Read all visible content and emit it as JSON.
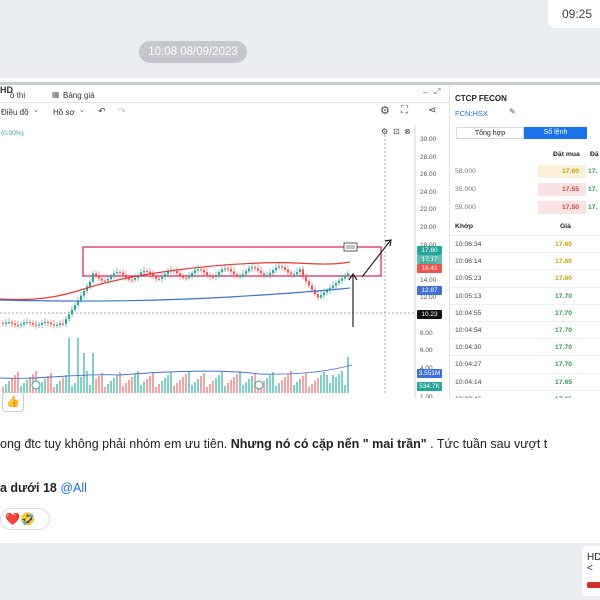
{
  "top_time": "09:25",
  "date_separator": "10:08 08/09/2023",
  "toolbar": {
    "hd_label": "HD",
    "tab_chart": "ồ thị",
    "tab_price_table": "Bảng giá",
    "menu_chart": "Điều đồ",
    "menu_profile": "Hồ sơ",
    "pct_change": "(0.00%)"
  },
  "price_axis": [
    "30.00",
    "28.00",
    "26.00",
    "24.00",
    "22.00",
    "20.00",
    "18.00",
    "16.00",
    "14.00",
    "12.00",
    "10.00",
    "8.00",
    "6.00",
    "4.00",
    "2.00",
    "1.00"
  ],
  "price_tags": {
    "last": "17.60",
    "mid": "17.17",
    "red": "16.41",
    "ma": "12.87",
    "ref": "10.23",
    "vol1": "3.551M",
    "vol2": "534.7K"
  },
  "order_panel": {
    "company": "CTCP FECON",
    "ticker": "FCN:HSX",
    "tab_summary": "Tổng hợp",
    "tab_orders": "Sổ lệnh",
    "col_bid": "Đặt mua",
    "col_ask": "Đặ",
    "book": [
      {
        "vol": "58.000",
        "price": "17.60",
        "ask": "17."
      },
      {
        "vol": "35.000",
        "price": "17.55",
        "ask": "17."
      },
      {
        "vol": "59.000",
        "price": "17.50",
        "ask": "17."
      }
    ],
    "trades_header_time": "Khớp",
    "trades_header_price": "Giá",
    "trades": [
      {
        "time": "10:06:34",
        "price": "17.60"
      },
      {
        "time": "10:06:14",
        "price": "17.60"
      },
      {
        "time": "10:05:23",
        "price": "17.60"
      },
      {
        "time": "10:05:13",
        "price": "17.70"
      },
      {
        "time": "10:04:55",
        "price": "17.70"
      },
      {
        "time": "10:04:54",
        "price": "17.70"
      },
      {
        "time": "10:04:30",
        "price": "17.70"
      },
      {
        "time": "10:04:27",
        "price": "17.70"
      },
      {
        "time": "10:04:14",
        "price": "17.65"
      },
      {
        "time": "10:03:46",
        "price": "17.65"
      }
    ]
  },
  "message": {
    "line1_normal": "ong đtc tuy không phải nhóm em ưu tiên. ",
    "line1_bold": "Nhưng nó có cặp nến \" mai trần\"",
    "line1_tail": " . Tức tuần sau vượt t",
    "line2_bold": "a dưới 18 ",
    "line2_mention": "@All",
    "reactions": "❤️🤣"
  },
  "side_card": {
    "label": "HD",
    "chevron": "<"
  },
  "colors": {
    "up": "#26a69a",
    "down": "#ef5350",
    "ma_red": "#e53935",
    "ma_blue": "#3f6fd8",
    "box": "#d81b60"
  }
}
